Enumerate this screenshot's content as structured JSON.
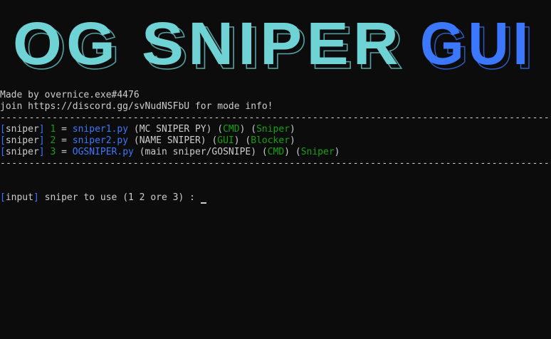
{
  "banner": {
    "part1": "OG SNIPER",
    "part2": "GUI",
    "color1": "#6fd3d6",
    "color2": "#3b78ff"
  },
  "header": {
    "made_by": "Made by overnice.exe#4476",
    "join": "join https://discord.gg/svNudNSFbU for mode info!"
  },
  "separator": "--------------------------------------------------------------------------------------------------",
  "options": [
    {
      "tag": "sniper",
      "number": "1",
      "eq": "=",
      "file": "sniper1.py",
      "desc": "(MC SNIPER PY)",
      "mode": "CMD",
      "kind": "Sniper"
    },
    {
      "tag": "sniper",
      "number": "2",
      "eq": "=",
      "file": "sniper2.py",
      "desc": "(NAME SNIPER)",
      "mode": "GUI",
      "kind": "Blocker"
    },
    {
      "tag": "sniper",
      "number": "3",
      "eq": "=",
      "file": "OGSNIPER.py",
      "desc": "(main sniper/GOSNIPE)",
      "mode": "CMD",
      "kind": "Sniper"
    }
  ],
  "prompt": {
    "tag": "input",
    "text": "sniper to use (1 2 ore 3) :"
  }
}
